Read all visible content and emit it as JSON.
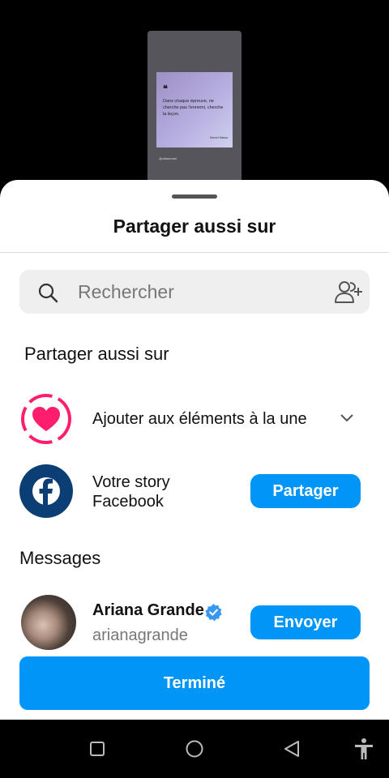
{
  "preview": {
    "quote_mark": "❝",
    "quote_text": "Dans chaque épreuve, ne cherche pas l'ennemi, cherche la leçon.",
    "quote_author": "Sensei Massa",
    "handle": "@citasensei"
  },
  "sheet": {
    "title": "Partager aussi sur"
  },
  "search": {
    "placeholder": "Rechercher",
    "icon": "search-icon",
    "add_people_icon": "add-people-icon"
  },
  "share_section": {
    "heading": "Partager aussi sur",
    "highlight": {
      "label": "Ajouter aux éléments à la une",
      "icon": "highlight-heart-icon",
      "accent": "#ff1e6d"
    },
    "facebook": {
      "label_line1": "Votre story",
      "label_line2": "Facebook",
      "icon": "facebook-icon",
      "brand_color": "#0b3e74",
      "button": "Partager"
    }
  },
  "messages": {
    "heading": "Messages",
    "contacts": [
      {
        "name": "Ariana Grande",
        "handle": "arianagrande",
        "verified": true,
        "button": "Envoyer"
      }
    ]
  },
  "footer": {
    "done": "Terminé"
  },
  "colors": {
    "primary": "#0095f6",
    "verified": "#3897f0"
  },
  "navbar": {
    "icons": [
      "recent-apps-icon",
      "home-icon",
      "back-icon",
      "accessibility-icon"
    ]
  }
}
